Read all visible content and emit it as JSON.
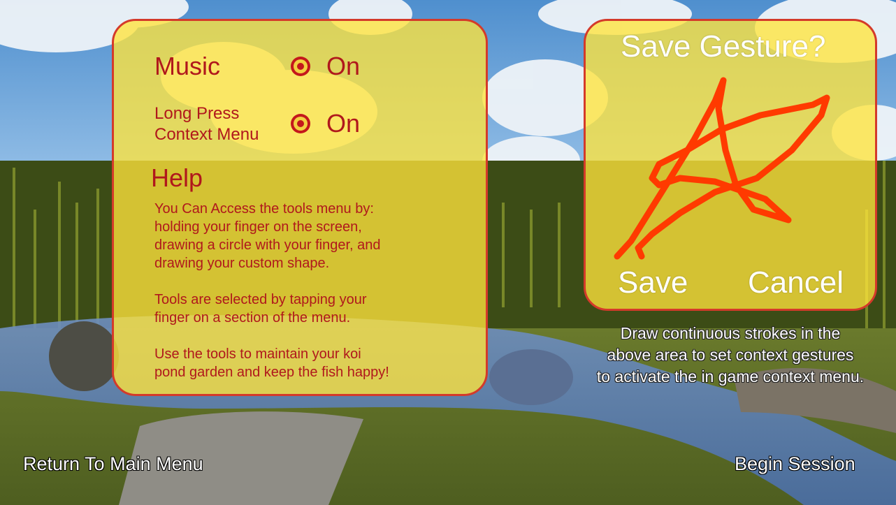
{
  "settings": {
    "music_label": "Music",
    "music_value": "On",
    "long_press_label_1": "Long Press",
    "long_press_label_2": "Context Menu",
    "long_press_value": "On",
    "help_title": "Help",
    "help_paragraphs": [
      [
        "You Can Access the tools menu by:",
        "holding your finger on the screen,",
        "drawing a circle with your finger, and",
        "drawing your custom shape."
      ],
      [
        "Tools are selected by tapping your",
        "finger on a section of the menu."
      ],
      [
        "Use the tools to maintain your koi",
        "pond garden and keep the fish happy!"
      ]
    ]
  },
  "gesture": {
    "title": "Save Gesture?",
    "save_label": "Save",
    "cancel_label": "Cancel",
    "stroke_color": "#ff3a00",
    "instructions": [
      "Draw continuous strokes in the",
      "above area to set context gestures",
      "to activate the in game context menu."
    ]
  },
  "footer": {
    "return_label": "Return To Main Menu",
    "begin_label": "Begin Session"
  },
  "colors": {
    "panel_fill": "#ffe43c",
    "panel_border": "#d43a2a",
    "text_red": "#b0181c"
  }
}
